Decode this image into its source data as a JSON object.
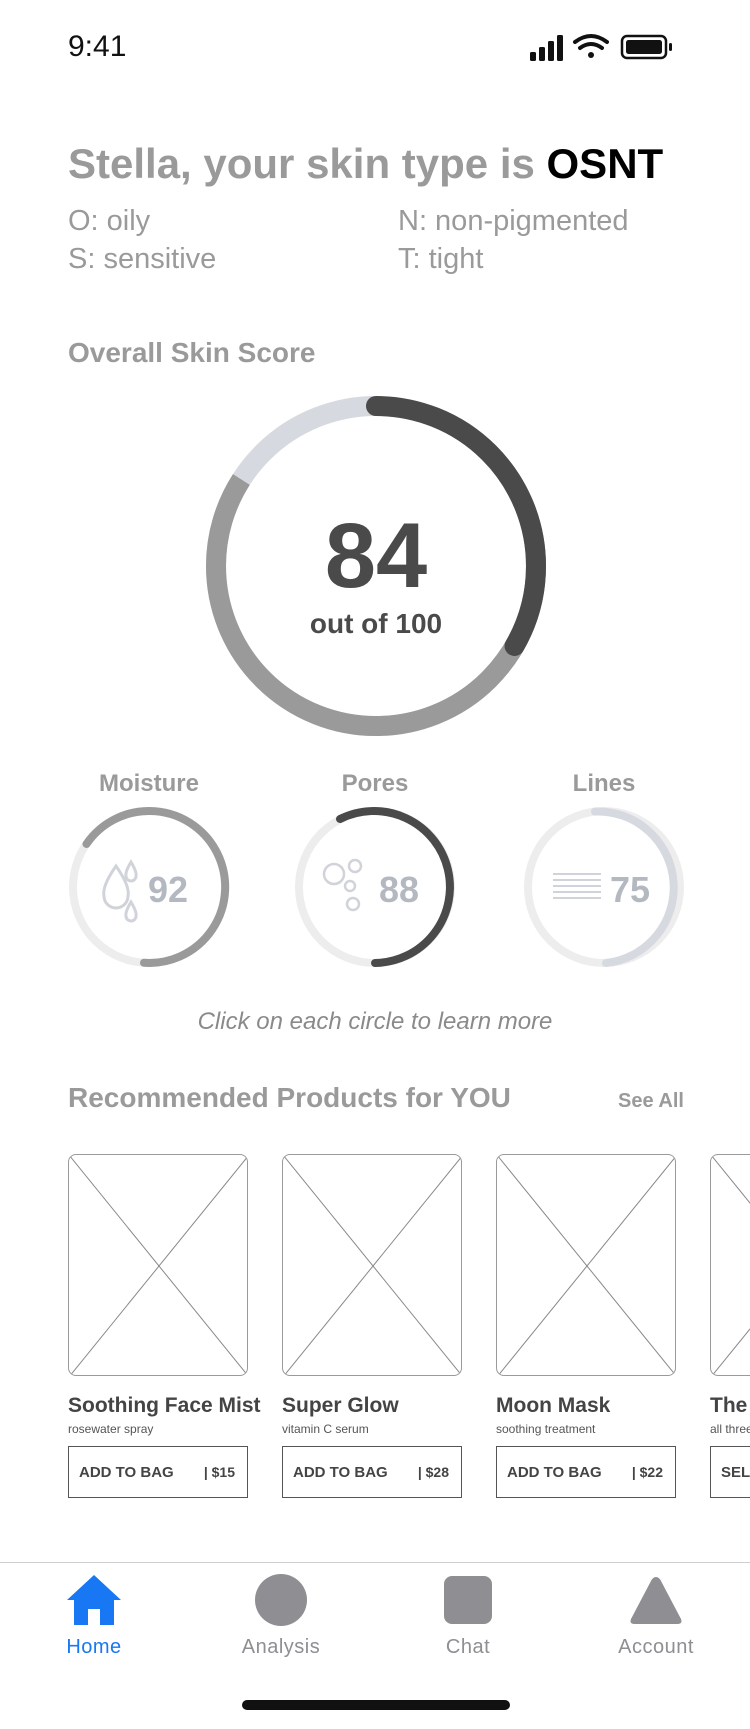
{
  "status_bar": {
    "time": "9:41"
  },
  "header": {
    "greeting_prefix": "Stella, your skin type is ",
    "skin_type": "OSNT",
    "traits": [
      {
        "text": "O: oily"
      },
      {
        "text": "N: non-pigmented"
      },
      {
        "text": "S: sensitive"
      },
      {
        "text": "T: tight"
      }
    ]
  },
  "overall": {
    "title": "Overall Skin Score",
    "score": "84",
    "out_of_label": "out of 100",
    "score_fraction": 0.84
  },
  "metrics": [
    {
      "label": "Moisture",
      "value": "92",
      "fraction": 0.92,
      "icon": "water-drops-icon",
      "color": "#9a9a9a"
    },
    {
      "label": "Pores",
      "value": "88",
      "fraction": 0.88,
      "icon": "bubbles-icon",
      "color": "#4a4a4a"
    },
    {
      "label": "Lines",
      "value": "75",
      "fraction": 0.75,
      "icon": "lines-icon",
      "color": "#d6d9e0"
    }
  ],
  "hint": "Click on each circle to learn more",
  "recommended": {
    "title": "Recommended Products for YOU",
    "see_all": "See All",
    "products": [
      {
        "name": "Soothing Face Mist",
        "subtitle": "rosewater spray",
        "button": "ADD TO BAG",
        "price": "| $15"
      },
      {
        "name": "Super Glow",
        "subtitle": "vitamin C serum",
        "button": "ADD TO BAG",
        "price": "| $28"
      },
      {
        "name": "Moon Mask",
        "subtitle": "soothing treatment",
        "button": "ADD TO BAG",
        "price": "| $22"
      },
      {
        "name": "The s",
        "subtitle": "all three",
        "button": "SELL",
        "price": ""
      }
    ]
  },
  "tabs": [
    {
      "label": "Home",
      "icon": "home-icon",
      "active": true
    },
    {
      "label": "Analysis",
      "icon": "circle-icon",
      "active": false
    },
    {
      "label": "Chat",
      "icon": "square-icon",
      "active": false
    },
    {
      "label": "Account",
      "icon": "triangle-icon",
      "active": false
    }
  ],
  "colors": {
    "accent": "#1877f2",
    "muted_text": "#9a9a9a",
    "dark": "#4a4a4a"
  }
}
